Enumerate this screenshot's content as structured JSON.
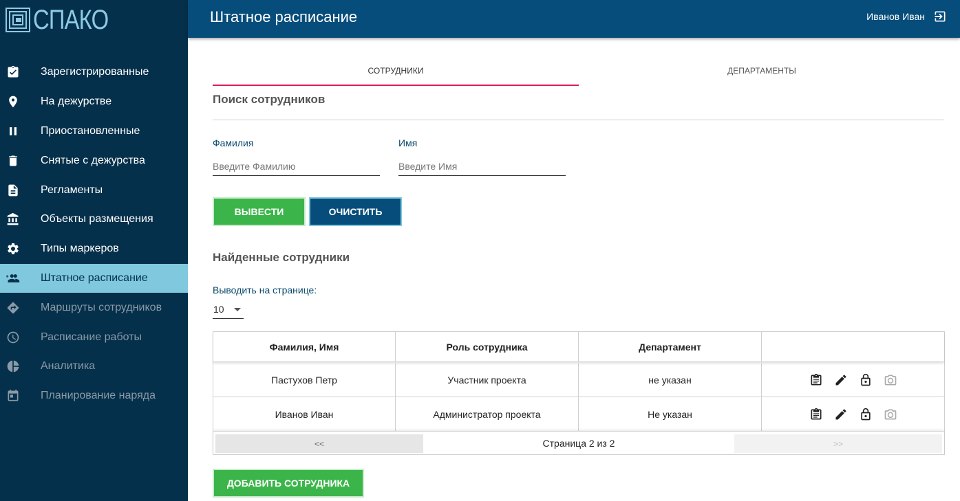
{
  "app": {
    "logo_text": "СПАКО"
  },
  "sidebar": {
    "items": [
      {
        "label": "Зарегистрированные",
        "icon": "checklist-icon"
      },
      {
        "label": "На дежурстве",
        "icon": "location-pin-icon"
      },
      {
        "label": "Приостановленные",
        "icon": "pause-icon"
      },
      {
        "label": "Снятые с дежурства",
        "icon": "trash-icon"
      },
      {
        "label": "Регламенты",
        "icon": "document-icon"
      },
      {
        "label": "Объекты размещения",
        "icon": "bank-icon"
      },
      {
        "label": "Типы маркеров",
        "icon": "gear-icon"
      },
      {
        "label": "Штатное расписание",
        "icon": "add-group-icon"
      },
      {
        "label": "Маршруты сотрудников",
        "icon": "directions-icon"
      },
      {
        "label": "Расписание работы",
        "icon": "clock-icon"
      },
      {
        "label": "Аналитика",
        "icon": "pie-chart-icon"
      },
      {
        "label": "Планирование наряда",
        "icon": "calendar-icon"
      }
    ],
    "active_index": 7
  },
  "header": {
    "title": "Штатное расписание",
    "user_name": "Иванов Иван"
  },
  "tabs": [
    {
      "label": "Сотрудники",
      "active": true
    },
    {
      "label": "Департаменты",
      "active": false
    }
  ],
  "search": {
    "title": "Поиск сотрудников",
    "last_name_label": "Фамилия",
    "last_name_placeholder": "Введите Фамилию",
    "first_name_label": "Имя",
    "first_name_placeholder": "Введите Имя",
    "submit_label": "Вывести",
    "clear_label": "Очистить"
  },
  "results": {
    "title": "Найденные сотрудники",
    "per_page_label": "Выводить на странице:",
    "per_page_value": "10",
    "columns": [
      "Фамилия, Имя",
      "Роль сотрудника",
      "Департамент",
      ""
    ],
    "rows": [
      {
        "name": "Пастухов Петр",
        "role": "Участник проекта",
        "department": "не указан"
      },
      {
        "name": "Иванов Иван",
        "role": "Администратор проекта",
        "department": "Не указан"
      }
    ],
    "pager": {
      "prev": "<<",
      "info": "Страница 2 из 2",
      "next": ">>"
    },
    "add_label": "Добавить сотрудника"
  },
  "colors": {
    "sidebar_bg": "#05304b",
    "header_bg": "#064d7b",
    "active_item": "#7fc8dd",
    "tab_underline": "#d81b60",
    "green_button": "#3bb54a"
  }
}
